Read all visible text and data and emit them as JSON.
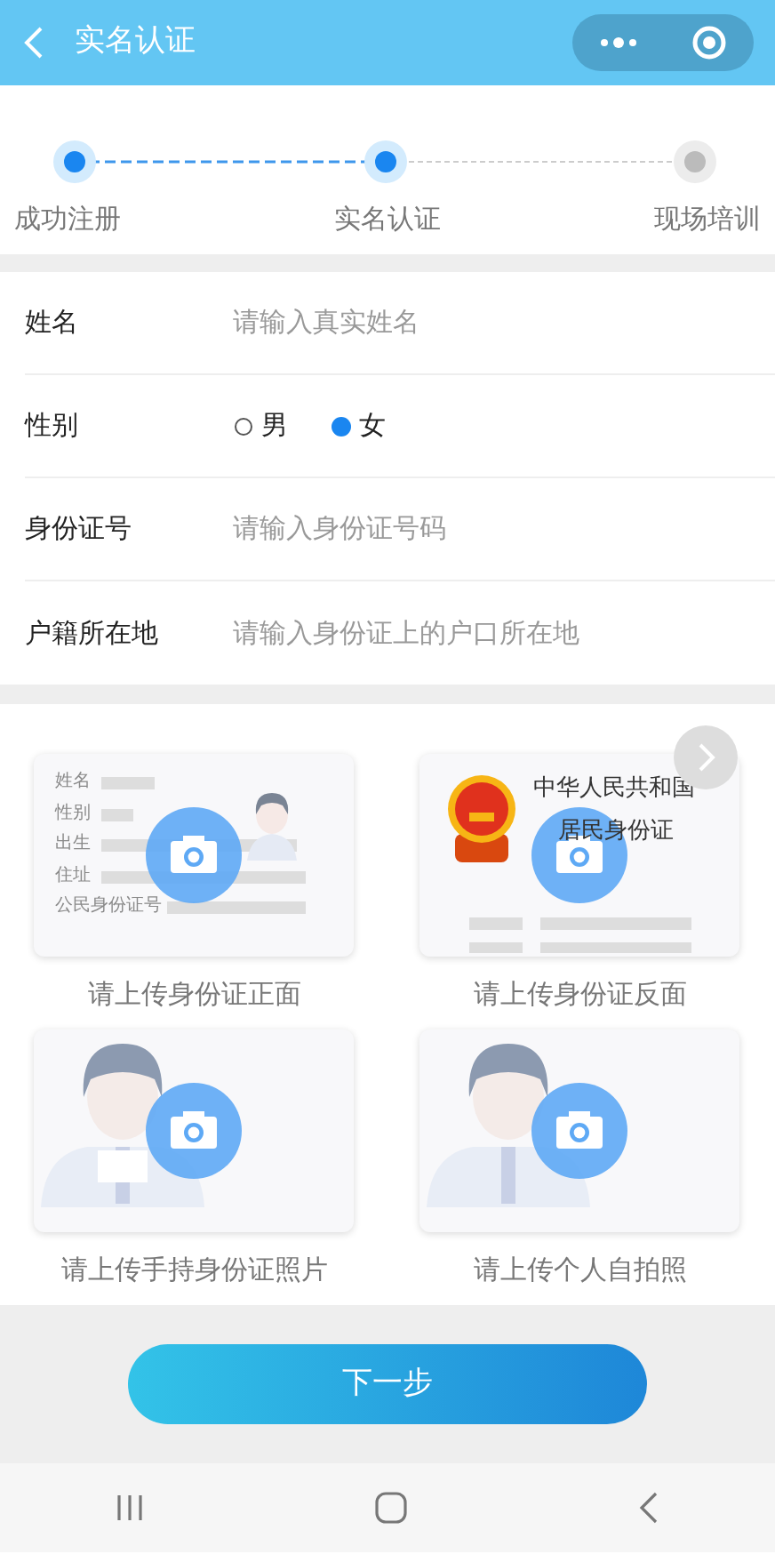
{
  "header": {
    "title": "实名认证"
  },
  "steps": [
    {
      "label": "成功注册",
      "done": true
    },
    {
      "label": "实名认证",
      "done": true
    },
    {
      "label": "现场培训",
      "done": false
    }
  ],
  "form": [
    {
      "kind": "text",
      "label": "姓名",
      "placeholder": "请输入真实姓名"
    },
    {
      "kind": "radio",
      "label": "性别",
      "options": [
        {
          "label": "男",
          "selected": false
        },
        {
          "label": "女",
          "selected": true
        }
      ]
    },
    {
      "kind": "text",
      "label": "身份证号",
      "placeholder": "请输入身份证号码"
    },
    {
      "kind": "text",
      "label": "户籍所在地",
      "placeholder": "请输入身份证上的户口所在地"
    }
  ],
  "uploads": [
    {
      "kind": "id_front",
      "caption": "请上传身份证正面",
      "labels": [
        "姓名",
        "性别",
        "出生",
        "住址",
        "公民身份证号"
      ]
    },
    {
      "kind": "id_back",
      "caption": "请上传身份证反面",
      "title": "中华人民共和国",
      "subtitle": "居民身份证"
    },
    {
      "kind": "holding",
      "caption": "请上传手持身份证照片"
    },
    {
      "kind": "selfie",
      "caption": "请上传个人自拍照"
    }
  ],
  "next_button": {
    "label": "下一步"
  }
}
